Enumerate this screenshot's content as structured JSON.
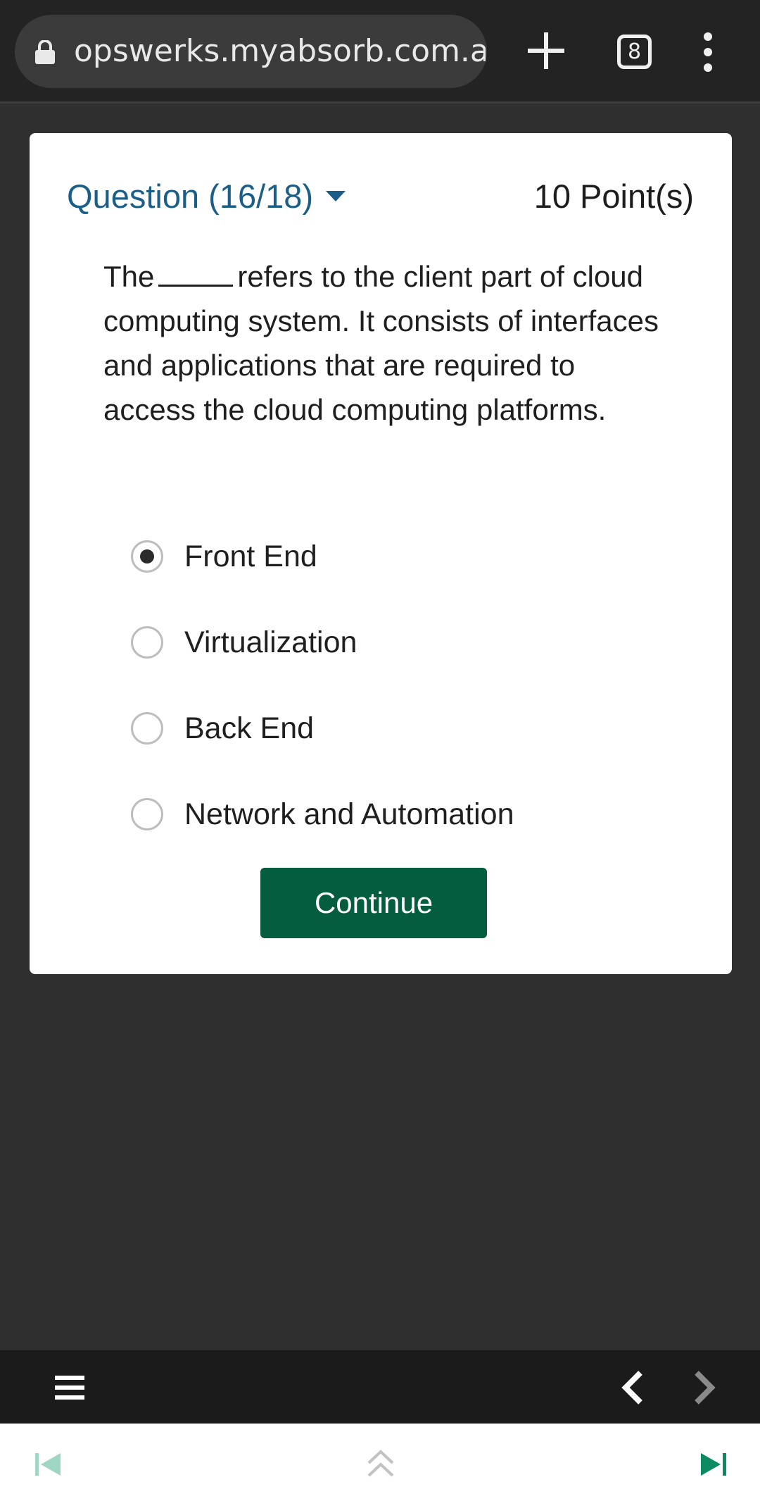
{
  "browser": {
    "url": "opswerks.myabsorb.com.au",
    "tab_count": "8"
  },
  "quiz": {
    "question_label": "Question (16/18)",
    "points": "10 Point(s)",
    "question_before_blank": "The",
    "question_after_blank": "refers to the client part of cloud computing system. It consists of interfaces and applications that are required to access the cloud computing platforms.",
    "options": [
      {
        "label": "Front End",
        "selected": true
      },
      {
        "label": "Virtualization",
        "selected": false
      },
      {
        "label": "Back End",
        "selected": false
      },
      {
        "label": "Network and Automation",
        "selected": false
      }
    ],
    "continue_label": "Continue"
  },
  "colors": {
    "accent_blue": "#1b5e87",
    "button_green": "#045d3f",
    "nav_teal": "#0c8a62"
  },
  "icons": {
    "lock": "lock-icon",
    "new_tab": "plus-icon",
    "tabs": "tab-count-icon",
    "menu": "more-vert-icon",
    "dropdown": "caret-down-icon",
    "toolbar_menu": "hamburger-icon",
    "prev": "chevron-left-icon",
    "next": "chevron-right-icon",
    "skip_back": "skip-previous-icon",
    "up": "double-chevron-up-icon",
    "skip_forward": "skip-next-icon"
  }
}
